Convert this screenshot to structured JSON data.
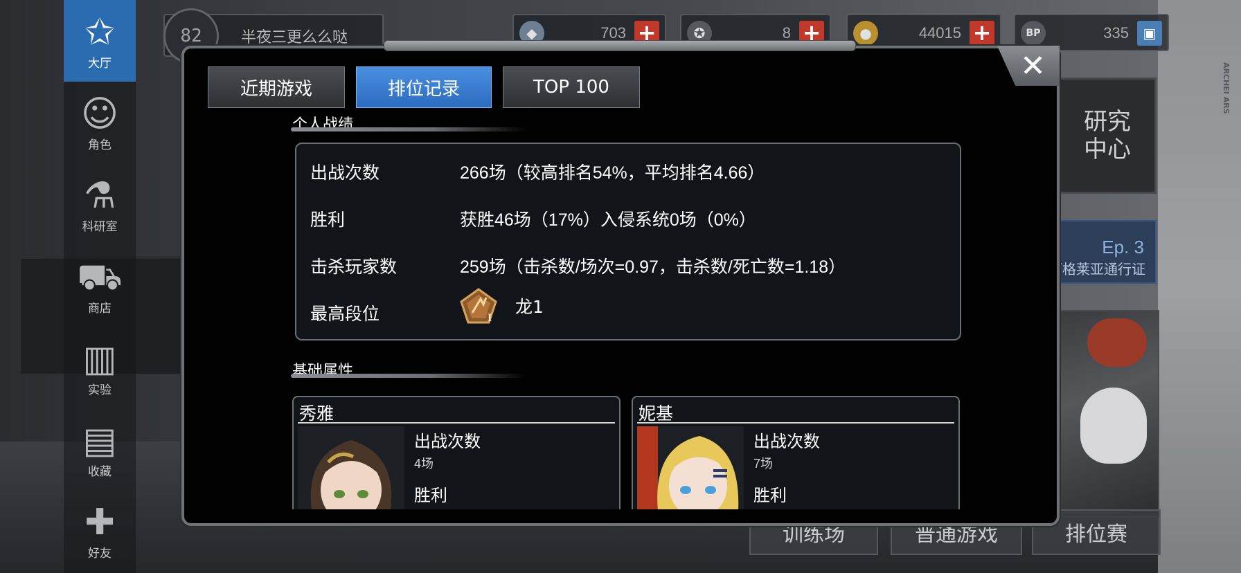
{
  "sidebar": {
    "items": [
      {
        "label": "大厅",
        "icon": "star-a-icon"
      },
      {
        "label": "角色",
        "icon": "character-icon"
      },
      {
        "label": "科研室",
        "icon": "flask-icon"
      },
      {
        "label": "商店",
        "icon": "cart-icon"
      },
      {
        "label": "实验",
        "icon": "books-icon"
      },
      {
        "label": "收藏",
        "icon": "open-book-icon"
      },
      {
        "label": "好友",
        "icon": "gamepad-icon"
      }
    ]
  },
  "player": {
    "level": "82",
    "name": "半夜三更么么哒"
  },
  "resources": [
    {
      "icon": "crystal-icon",
      "value": "703",
      "action": "+"
    },
    {
      "icon": "ticket-icon",
      "value": "8",
      "action": "+"
    },
    {
      "icon": "coin-icon",
      "value": "44015",
      "action": "+"
    },
    {
      "icon": "bp-icon",
      "value": "335",
      "action": "▣"
    }
  ],
  "right_panel": {
    "research": "研究中心",
    "pass_ep": "Ep. 3",
    "pass_label": "阿格莱亚通行证",
    "brand": "ARCHEI ARS"
  },
  "modes": {
    "training": "训练场",
    "normal": "普通游戏",
    "ranked": "排位赛"
  },
  "modal": {
    "close": "✕",
    "tabs": [
      "近期游戏",
      "排位记录",
      "TOP 100"
    ],
    "active_tab": 1,
    "personal_title": "个人战绩",
    "stats": [
      {
        "label": "出战次数",
        "value": "266场（较高排名54%，平均排名4.66）"
      },
      {
        "label": "胜利",
        "value": "获胜46场（17%）入侵系统0场（0%）"
      },
      {
        "label": "击杀玩家数",
        "value": "259场（击杀数/场次=0.97，击杀数/死亡数=1.18）"
      },
      {
        "label": "最高段位",
        "value": "龙1"
      }
    ],
    "base_title": "基础属性",
    "characters": [
      {
        "name": "秀雅",
        "battles_label": "出战次数",
        "battles_value": "4场",
        "win_label": "胜利"
      },
      {
        "name": "妮基",
        "battles_label": "出战次数",
        "battles_value": "7场",
        "win_label": "胜利"
      }
    ]
  },
  "colors": {
    "accent_blue": "#2d6cc0",
    "modal_bg": "#010101",
    "panel_bg": "#111419",
    "add_red": "#c0392b"
  }
}
